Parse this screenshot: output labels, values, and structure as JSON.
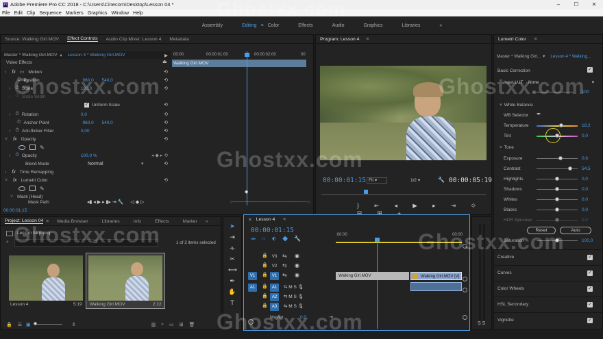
{
  "window": {
    "title": "Adobe Premiere Pro CC 2018 - C:\\Users\\Cinecom\\Desktop\\Lesson 04 *",
    "app_icon": "Pr"
  },
  "menu": [
    "File",
    "Edit",
    "Clip",
    "Sequence",
    "Markers",
    "Graphics",
    "Window",
    "Help"
  ],
  "workspaces": [
    {
      "label": "Assembly",
      "active": false
    },
    {
      "label": "Editing",
      "active": true
    },
    {
      "label": "Color",
      "active": false
    },
    {
      "label": "Effects",
      "active": false
    },
    {
      "label": "Audio",
      "active": false
    },
    {
      "label": "Graphics",
      "active": false
    },
    {
      "label": "Libraries",
      "active": false
    }
  ],
  "source_panel": {
    "tabs": [
      "Source: Walking Girl.MOV",
      "Effect Controls",
      "Audio Clip Mixer: Lesson 4",
      "Metadata"
    ],
    "master": "Master * Walking Girl.MOV",
    "sequence": "Lesson 4 * Walking Girl.MOV",
    "ruler": [
      "00:00",
      "00:00:01:00",
      "00:00:02:00",
      "00"
    ],
    "clip_name": "Walking Girl.MOV",
    "video_effects": "Video Effects",
    "params": [
      {
        "label": "Motion",
        "fx": true
      },
      {
        "label": "Position",
        "v1": "960,0",
        "v2": "540,0"
      },
      {
        "label": "Scale",
        "v1": "100,0"
      },
      {
        "label": "Scale Width"
      },
      {
        "label": "Uniform Scale",
        "checkbox": true
      },
      {
        "label": "Rotation",
        "v1": "0,0"
      },
      {
        "label": "Anchor Point",
        "v1": "960,0",
        "v2": "540,0"
      },
      {
        "label": "Anti-flicker Filter",
        "v1": "0,00"
      },
      {
        "label": "Opacity",
        "fx": true
      },
      {
        "label": "Opacity",
        "v1": "100,0 %"
      },
      {
        "label": "Blend Mode",
        "v1": "Normal"
      },
      {
        "label": "Time Remapping",
        "fx": true
      },
      {
        "label": "Lumetri Color",
        "fx": true
      },
      {
        "label": "Mask (Head)"
      },
      {
        "label": "Mask Path"
      }
    ],
    "timecode": "00:00:01:15"
  },
  "program": {
    "title": "Program: Lesson 4",
    "timecode": "00:00:01:15",
    "fit": "Fit",
    "resolution": "1/2",
    "duration": "00:00:05:19"
  },
  "lumetri": {
    "title": "Lumetri Color",
    "master": "Master * Walking Girl...",
    "sequence": "Lesson 4 * Walking...",
    "basic": "Basic Correction",
    "input_lut_label": "Input LUT",
    "input_lut_value": "None",
    "intensity": "100",
    "white_balance": "White Balance",
    "wb_selector": "WB Selector",
    "temperature": {
      "label": "Temperature",
      "value": "18,2"
    },
    "tint": {
      "label": "Tint",
      "value": "0,0"
    },
    "tone": "Tone",
    "tone_rows": [
      {
        "label": "Exposure",
        "value": "0,6"
      },
      {
        "label": "Contrast",
        "value": "54,5"
      },
      {
        "label": "Highlights",
        "value": "0,0"
      },
      {
        "label": "Shadows",
        "value": "0,0"
      },
      {
        "label": "Whites",
        "value": "0,0"
      },
      {
        "label": "Blacks",
        "value": "0,0"
      },
      {
        "label": "HDR Specular",
        "value": "0,0"
      }
    ],
    "reset": "Reset",
    "auto": "Auto",
    "saturation": {
      "label": "Saturation",
      "value": "100,0"
    },
    "sections": [
      "Creative",
      "Curves",
      "Color Wheels",
      "HSL Secondary",
      "Vignette"
    ]
  },
  "project": {
    "tabs": [
      "Project: Lesson 04",
      "Media Browser",
      "Libraries",
      "Info",
      "Effects",
      "Marker"
    ],
    "file": "Lesson 04.prproj",
    "count": "1 of 2 items selected",
    "items": [
      {
        "name": "Lesson 4",
        "duration": "5:19"
      },
      {
        "name": "Walking Girl.MOV",
        "duration": "2:22"
      }
    ]
  },
  "timeline": {
    "tab": "Lesson 4",
    "timecode": "00:00:01:15",
    "ruler": [
      ":00:00",
      "00:00"
    ],
    "video_tracks": [
      "V3",
      "V2",
      "V1"
    ],
    "audio_tracks": [
      "A1",
      "A2",
      "A3"
    ],
    "src_v": "V1",
    "src_a": "A1",
    "master": "Master",
    "master_val": "0,0",
    "clip1": "Walking Girl.MOV",
    "clip2": "Walking Girl.MOV [V]"
  },
  "watermark": "Ghostxx.com",
  "colors": {
    "accent": "#4a9ce8",
    "panel": "#232323",
    "bg": "#1d1d1d"
  }
}
